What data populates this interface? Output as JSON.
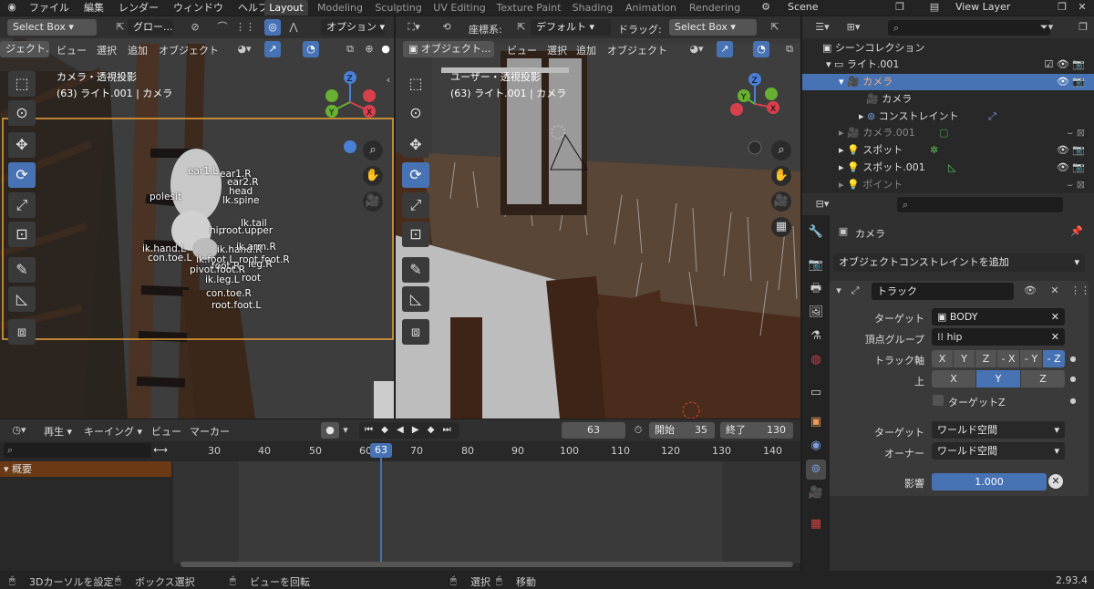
{
  "menubar": {
    "items": [
      "ファイル",
      "編集",
      "レンダー",
      "ウィンドウ",
      "ヘルプ"
    ],
    "workspaces": [
      "Layout",
      "Modeling",
      "Sculpting",
      "UV Editing",
      "Texture Paint",
      "Shading",
      "Animation",
      "Rendering"
    ],
    "scene": "Scene",
    "view_layer": "View Layer"
  },
  "left_viewport": {
    "select_mode": "Select Box",
    "orientation": "グロー...",
    "options": "オプション",
    "mode": "ジェクト...",
    "menu": [
      "ビュー",
      "選択",
      "追加",
      "オブジェクト"
    ],
    "overlay_title": "カメラ・透視投影",
    "overlay_sub": "(63) ライト.001 | カメラ",
    "bones": [
      "ear1.L",
      "ear1.R",
      "ear2.R",
      "head",
      "lk.spine",
      "polesit",
      "lk.tail",
      "hip",
      "root.upper",
      "ik.hand.L",
      "ik.hand.R",
      "ik.arm.R",
      "con.toe.L",
      "ik.foot.L",
      "root.foot.R",
      "foot.R",
      "leg.R",
      "pivot.foot.R",
      "root",
      "ik.leg.L",
      "con.toe.R",
      "root.foot.L"
    ]
  },
  "right_viewport": {
    "coord_label": "座標系:",
    "coord_value": "デフォルト",
    "drag_label": "ドラッグ:",
    "select_mode": "Select Box",
    "mode": "オブジェクト...",
    "menu": [
      "ビュー",
      "選択",
      "追加",
      "オブジェクト"
    ],
    "overlay_title": "ユーザー・透視投影",
    "overlay_sub": "(63) ライト.001 | カメラ"
  },
  "timeline": {
    "menu": [
      "再生",
      "キーイング",
      "ビュー",
      "マーカー"
    ],
    "current_frame": "63",
    "start_label": "開始",
    "start": "35",
    "end_label": "終了",
    "end": "130",
    "ticks": [
      "30",
      "40",
      "50",
      "60",
      "70",
      "80",
      "90",
      "100",
      "110",
      "120",
      "130",
      "140"
    ],
    "summary": "概要"
  },
  "outliner": {
    "root": "シーンコレクション",
    "rows": [
      {
        "label": "ライト.001",
        "indent": 1
      },
      {
        "label": "カメラ",
        "indent": 2
      },
      {
        "label": "カメラ",
        "indent": 3
      },
      {
        "label": "コンストレイント",
        "indent": 3
      },
      {
        "label": "カメラ.001",
        "indent": 2
      },
      {
        "label": "スポット",
        "indent": 2
      },
      {
        "label": "スポット.001",
        "indent": 2
      },
      {
        "label": "ポイント",
        "indent": 2
      }
    ]
  },
  "properties": {
    "object_name": "カメラ",
    "add_constraint": "オブジェクトコンストレイントを追加",
    "constraint_name": "トラック",
    "target_label": "ターゲット",
    "target_value": "BODY",
    "vgroup_label": "頂点グループ",
    "vgroup_value": "hip",
    "track_axis_label": "トラック軸",
    "track_axes": [
      "X",
      "Y",
      "Z",
      "- X",
      "- Y",
      "- Z"
    ],
    "up_label": "上",
    "up_axes": [
      "X",
      "Y",
      "Z"
    ],
    "target_z": "ターゲットZ",
    "space_target_label": "ターゲット",
    "space_target_value": "ワールド空間",
    "owner_label": "オーナー",
    "owner_value": "ワールド空間",
    "influence_label": "影響",
    "influence_value": "1.000",
    "influence": 1.0
  },
  "statusbar": {
    "items": [
      "3Dカーソルを設定",
      "ボックス選択",
      "ビューを回転",
      "選択",
      "移動"
    ],
    "version": "2.93.4"
  },
  "colors": {
    "accent": "#4772b3",
    "selection_border": "#e9a33a",
    "timeline_head": "#4772b3",
    "summary_bg": "#6b3a14"
  }
}
